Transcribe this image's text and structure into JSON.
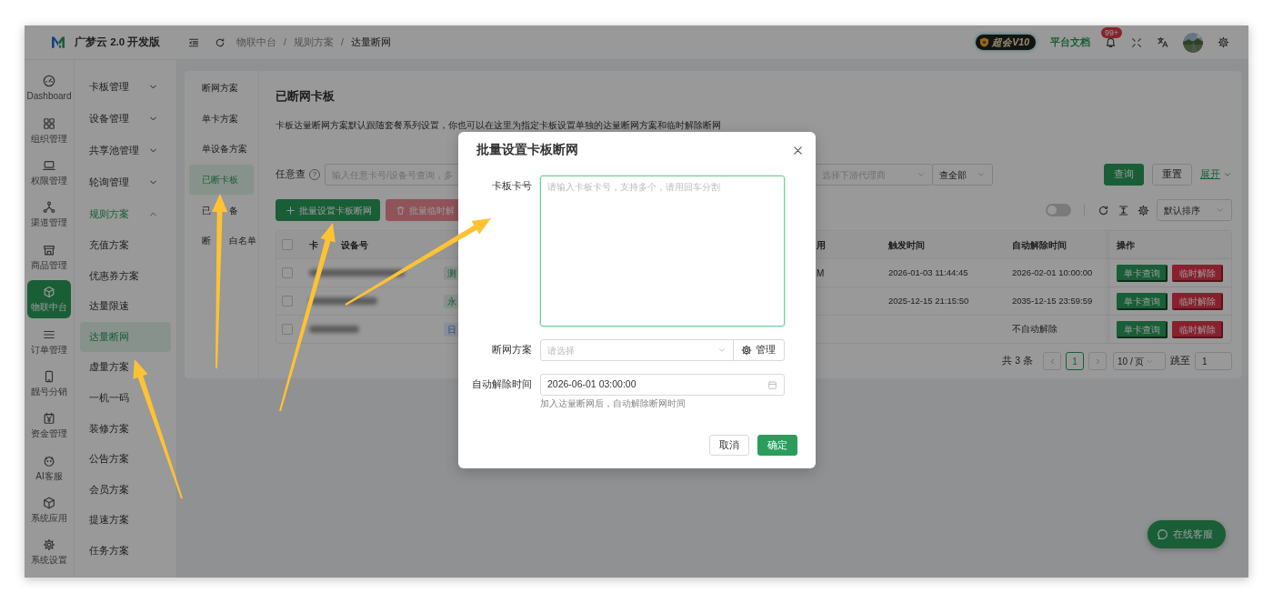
{
  "header": {
    "app_name": "广梦云 2.0 开发版",
    "breadcrumb": [
      {
        "kind": "link",
        "label": "物联中台"
      },
      {
        "kind": "separator",
        "label": "/"
      },
      {
        "kind": "link",
        "label": "规则方案"
      },
      {
        "kind": "separator",
        "label": "/"
      },
      {
        "kind": "current",
        "label": "达量断网"
      }
    ],
    "vip_badge": "超会V10",
    "docs_link": "平台文档",
    "notification_count": "99+"
  },
  "nav_rail": [
    {
      "label": "Dashboard",
      "selected": false
    },
    {
      "label": "组织管理",
      "selected": false
    },
    {
      "label": "权限管理",
      "selected": false
    },
    {
      "label": "渠道管理",
      "selected": false
    },
    {
      "label": "商品管理",
      "selected": false
    },
    {
      "label": "物联中台",
      "selected": true
    },
    {
      "label": "订单管理",
      "selected": false
    },
    {
      "label": "靓号分销",
      "selected": false
    },
    {
      "label": "资金管理",
      "selected": false
    },
    {
      "label": "AI客服",
      "selected": false
    },
    {
      "label": "系统应用",
      "selected": false
    },
    {
      "label": "系统设置",
      "selected": false
    }
  ],
  "submenu": [
    {
      "label": "卡板管理",
      "expanded": false,
      "selected": false
    },
    {
      "label": "设备管理",
      "expanded": false,
      "selected": false
    },
    {
      "label": "共享池管理",
      "expanded": false,
      "selected": false
    },
    {
      "label": "轮询管理",
      "expanded": false,
      "selected": false
    },
    {
      "label": "规则方案",
      "expanded": true,
      "selected": true,
      "children": [
        {
          "label": "充值方案",
          "selected": false
        },
        {
          "label": "优惠券方案",
          "selected": false
        },
        {
          "label": "达量限速",
          "selected": false
        },
        {
          "label": "达量断网",
          "selected": true
        },
        {
          "label": "虚量方案",
          "selected": false
        },
        {
          "label": "一机一码",
          "selected": false
        },
        {
          "label": "装修方案",
          "selected": false
        },
        {
          "label": "公告方案",
          "selected": false
        },
        {
          "label": "会员方案",
          "selected": false
        },
        {
          "label": "提速方案",
          "selected": false
        },
        {
          "label": "任务方案",
          "selected": false
        }
      ]
    }
  ],
  "page_tabs": [
    {
      "label": "断网方案",
      "selected": false
    },
    {
      "label": "单卡方案",
      "selected": false
    },
    {
      "label": "单设备方案",
      "selected": false
    },
    {
      "label": "已断卡板",
      "selected": true
    },
    {
      "label_parts": [
        "已",
        "备"
      ],
      "selected": false
    },
    {
      "label_parts": [
        "断",
        "白名单"
      ],
      "selected": false
    }
  ],
  "page": {
    "title": "已断网卡板",
    "description": "卡板达量断网方案默认跟随套餐系列设置，你也可以在这里为指定卡板设置单独的达量断网方案和临时解除断网"
  },
  "filters": {
    "label": "任意查",
    "help": "?",
    "search_placeholder": "输入任意卡号/设备号查询，多",
    "agent_placeholder": "选择下游代理商",
    "scope": "查全部",
    "buttons": [
      {
        "label": "查询",
        "kind": "primary"
      },
      {
        "label": "重置",
        "kind": "default"
      }
    ],
    "expand_link": "展开"
  },
  "toolbar": {
    "buttons": [
      {
        "label": "批量设置卡板断网",
        "kind": "primary"
      },
      {
        "label": "批量临时解",
        "kind": "danger"
      }
    ],
    "toggle_on": false,
    "sort": "默认排序"
  },
  "table": {
    "header_checked": false,
    "columns": [
      {
        "parts": [
          "卡",
          "设备号"
        ]
      },
      {
        "label": "用"
      },
      {
        "label": "触发时间"
      },
      {
        "label": "自动解除时间"
      },
      {
        "label": "操作"
      }
    ],
    "rows": [
      {
        "checked": false,
        "tag": {
          "text": "测",
          "kind": "success"
        },
        "column_4": "M",
        "trigger_time": "2026-01-03 11:44:45",
        "auto_release_time": "2026-02-01 10:00:00",
        "actions": [
          {
            "label": "单卡查询",
            "kind": "primary"
          },
          {
            "label": "临时解除",
            "kind": "danger"
          }
        ]
      },
      {
        "checked": false,
        "tag": {
          "text": "永",
          "kind": "success"
        },
        "trigger_time": "2025-12-15 21:15:50",
        "auto_release_time": "2035-12-15 23:59:59",
        "actions": [
          {
            "label": "单卡查询",
            "kind": "primary"
          },
          {
            "label": "临时解除",
            "kind": "danger"
          }
        ]
      },
      {
        "checked": false,
        "tag": {
          "text": "日",
          "kind": "info"
        },
        "auto_release_time": "不自动解除",
        "actions": [
          {
            "label": "单卡查询",
            "kind": "primary"
          },
          {
            "label": "临时解除",
            "kind": "danger"
          }
        ]
      }
    ]
  },
  "pagination": {
    "total": "共 3 条",
    "pages": [
      {
        "label": "1",
        "selected": true
      }
    ],
    "page_size": "10 / 页",
    "jump_label": "跳至",
    "jump_value": "1"
  },
  "modal": {
    "title": "批量设置卡板断网",
    "fields": [
      {
        "kind": "textarea",
        "label": "卡板卡号",
        "placeholder": "请输入卡板卡号，支持多个，请用回车分割"
      },
      {
        "kind": "select",
        "label": "断网方案",
        "placeholder": "请选择",
        "addon": "管理"
      },
      {
        "kind": "date",
        "label": "自动解除时间",
        "value": "2026-06-01 03:00:00",
        "help": "加入达量断网后，自动解除断网时间"
      }
    ],
    "buttons": [
      {
        "label": "取消",
        "kind": "default"
      },
      {
        "label": "确定",
        "kind": "primary"
      }
    ]
  },
  "chat_button": "在线客服"
}
